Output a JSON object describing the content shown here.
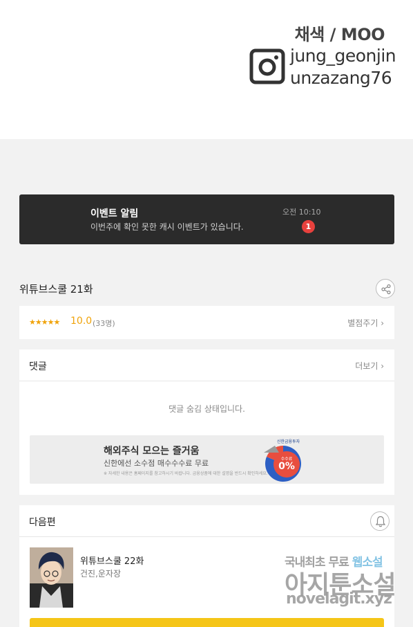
{
  "credits": {
    "artist": "채색 / MOO",
    "instagram_handles": [
      "jung_geonjin",
      "unzazang76"
    ],
    "instagram_icon": "instagram-icon"
  },
  "event": {
    "title": "이벤트 알림",
    "description": "이번주에 확인 못한 캐시 이벤트가 있습니다.",
    "time": "오전 10:10",
    "badge_count": "1"
  },
  "episode": {
    "title": "위튜브스쿨 21화",
    "share_icon": "share-icon"
  },
  "rating": {
    "stars": "★★★★★",
    "score": "10.0",
    "votes": "(33명)",
    "rate_label": "별점주기 ›"
  },
  "comments": {
    "title": "댓글",
    "more_label": "더보기 ›",
    "hidden_message": "댓글 숨김 상태입니다."
  },
  "ad": {
    "headline": "해외주식 모으는 즐거움",
    "subline": "신한에선 소수점 매수수수료 무료",
    "fine_print": "※ 자세한 내용은 홈페이지를 참고하시기 바랍니다. 금융상품에 대한 설명을 반드시 확인하세요.",
    "brand": "신한금융투자",
    "graphic_label": "수수료 0%"
  },
  "next": {
    "title": "다음편",
    "bell_icon": "bell-icon",
    "episode_title": "위튜브스쿨 22화",
    "authors": "건진,운자장"
  },
  "watermark": {
    "line1_prefix": "국내최초 무료",
    "line1_highlight": "웹소설",
    "line2": "아지툰소설",
    "line3": "novelagit.xyz"
  },
  "colors": {
    "accent": "#f0a30a",
    "event_bg": "#2b2b2b",
    "badge": "#e8413d",
    "cta": "#f5c518"
  }
}
